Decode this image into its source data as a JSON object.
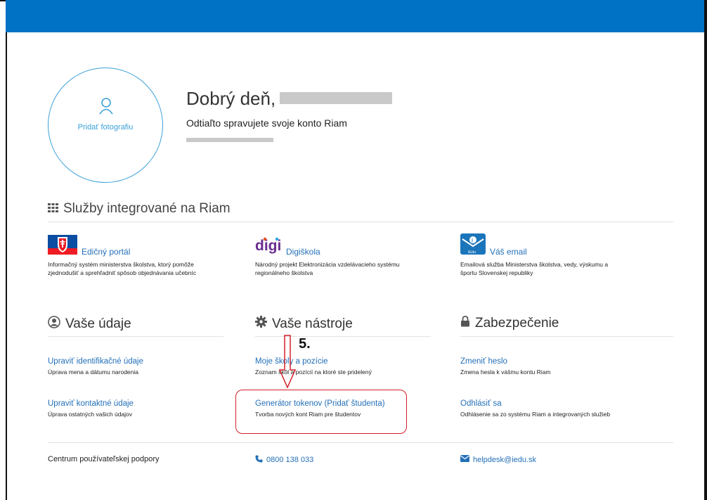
{
  "profile": {
    "add_photo": "Pridať fotografiu",
    "greeting": "Dobrý deň,",
    "subtitle": "Odtiaľto spravujete svoje konto Riam"
  },
  "services": {
    "title": "Služby integrované na Riam",
    "items": [
      {
        "label": "Edičný portál",
        "icon": "slovak-emblem-icon",
        "desc_line1": "Informačný systém ministerstva školstva, ktorý pomôže",
        "desc_line2": "zjednodušiť a sprehľadniť spôsob objednávania učebníc"
      },
      {
        "label": "Digiškola",
        "icon": "digi-logo",
        "logo_text": "digi",
        "desc_line1": "Národný projekt Elektronizácia vzdelávacieho systému",
        "desc_line2": "regionálneho školstva"
      },
      {
        "label": "Váš email",
        "icon": "email-logo-icon",
        "logo_text": "iEdu",
        "desc_line1": "Emailová služba Ministerstva školstva, vedy, výskumu a",
        "desc_line2": "športu Slovenskej republiky"
      }
    ]
  },
  "columns": {
    "data": {
      "title": "Vaše údaje",
      "items": [
        {
          "label": "Upraviť identifikačné údaje",
          "desc": "Úprava mena a dátumu narodenia"
        },
        {
          "label": "Upraviť kontaktné údaje",
          "desc": "Úprava ostatných vašich údajov"
        }
      ]
    },
    "tools": {
      "title": "Vaše nástroje",
      "items": [
        {
          "label": "Moje školy a pozície",
          "desc": "Zoznam škôl a pozícií na ktoré ste pridelený"
        },
        {
          "label": "Generátor tokenov (Pridať študenta)",
          "desc": "Tvorba nových kont Riam pre študentov"
        }
      ]
    },
    "security": {
      "title": "Zabezpečenie",
      "items": [
        {
          "label": "Zmeniť heslo",
          "desc": "Zmena hesla k vášmu kontu Riam"
        },
        {
          "label": "Odhlásiť sa",
          "desc": "Odhlásenie sa zo systému Riam a integrovaných služieb"
        }
      ]
    }
  },
  "annotation": {
    "step": "5."
  },
  "footer": {
    "support": "Centrum používateľskej podpory",
    "phone": "0800 138 033",
    "email": "helpdesk@iedu.sk"
  },
  "colors": {
    "brand": "#0072c6",
    "link": "#2470b8",
    "annotation": "#d3202a"
  }
}
